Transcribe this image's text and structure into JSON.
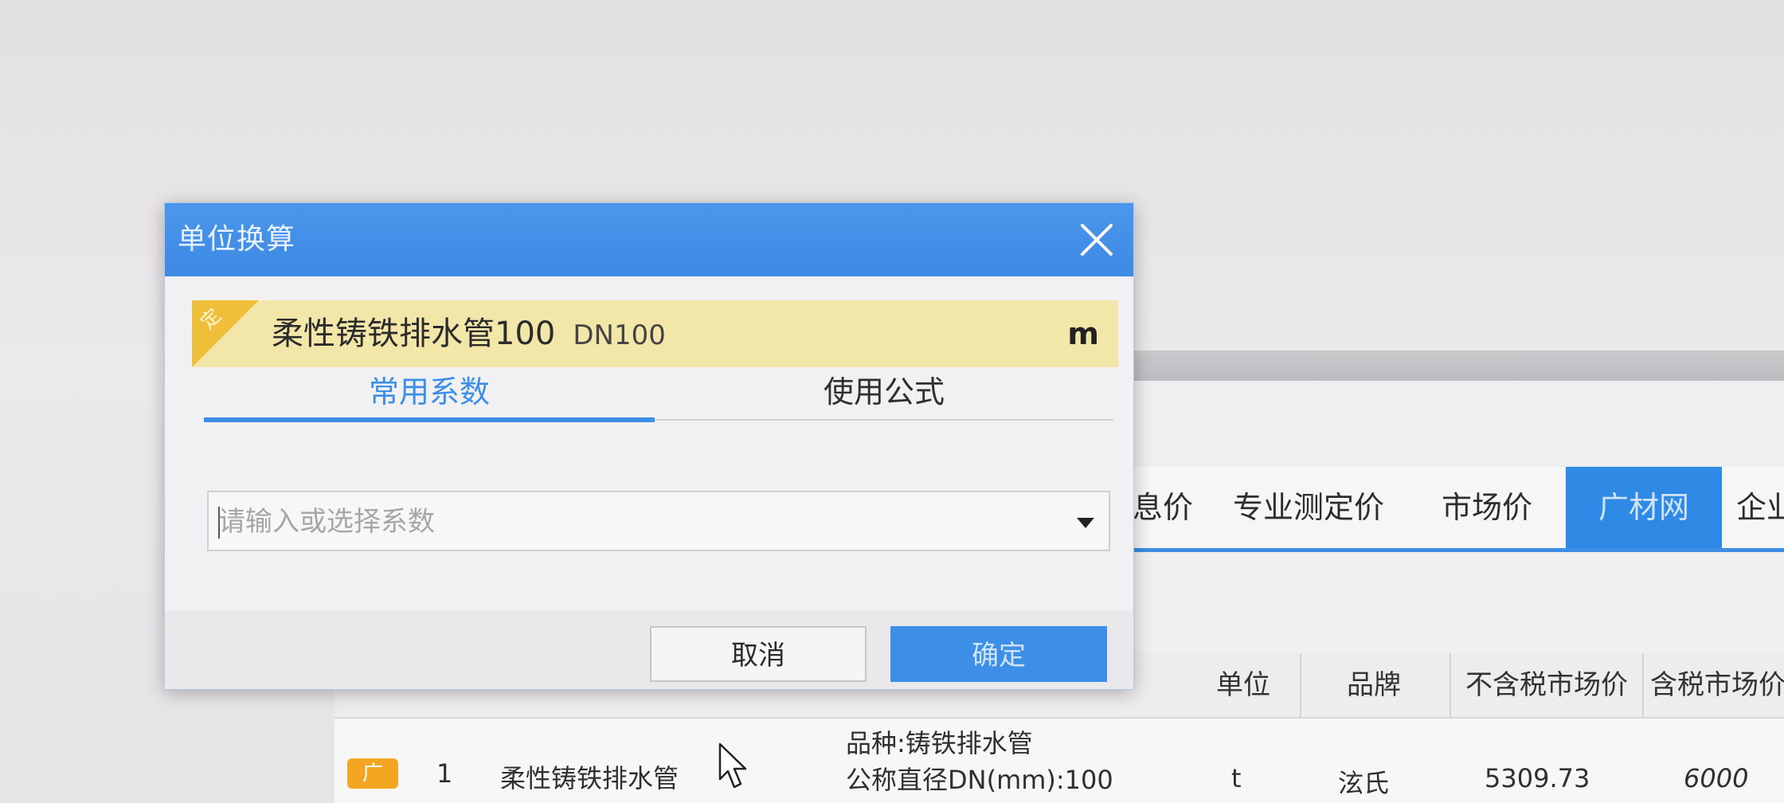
{
  "dialog": {
    "title": "单位换算",
    "material": {
      "tag": "定",
      "name": "柔性铸铁排水管100",
      "spec": "DN100",
      "unit": "m"
    },
    "tabs": [
      {
        "label": "常用系数",
        "active": true
      },
      {
        "label": "使用公式",
        "active": false
      }
    ],
    "coefficient": {
      "placeholder": "请输入或选择系数",
      "value": ""
    },
    "buttons": {
      "cancel": "取消",
      "ok": "确定"
    }
  },
  "background": {
    "tabs": [
      "息价",
      "专业测定价",
      "市场价",
      "广材网",
      "企业"
    ],
    "active_tab": "广材网",
    "columns": [
      "单位",
      "品牌",
      "不含税市场价",
      "含税市场价"
    ],
    "row": {
      "badge": "广",
      "index": "1",
      "name": "柔性铸铁排水管",
      "spec_line1": "品种:铸铁排水管",
      "spec_line2": "公称直径DN(mm):100",
      "unit": "t",
      "brand": "泫氏",
      "price_ex_tax": "5309.73",
      "price_inc_tax": "6000"
    }
  },
  "colors": {
    "accent": "#3d8ee6",
    "material_bar": "#f3e6a9",
    "tag": "#f0bf3a",
    "badge": "#f4a623"
  }
}
